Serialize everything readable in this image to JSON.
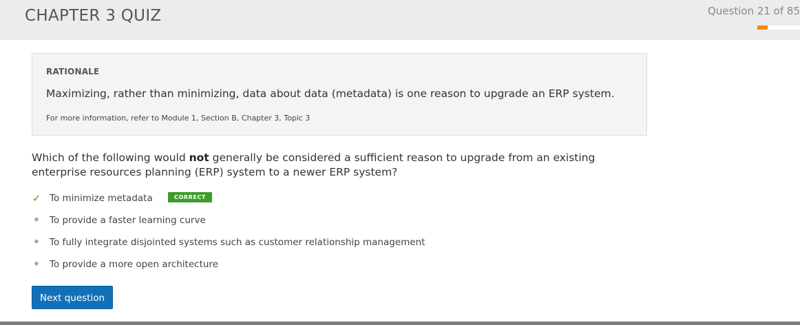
{
  "header": {
    "title": "CHAPTER 3 QUIZ",
    "progress_text": "Question 21 of 85",
    "progress": {
      "current": 21,
      "total": 85
    },
    "progress_color": "#ef8a1a"
  },
  "rationale": {
    "heading": "RATIONALE",
    "text": "Maximizing, rather than minimizing, data about data (metadata) is one reason to upgrade an ERP system.",
    "reference": "For more information, refer to Module 1, Section B, Chapter 3, Topic 3"
  },
  "question": {
    "before": "Which of the following would ",
    "emphasis": "not",
    "after": " generally be considered a sufficient reason to upgrade from an existing enterprise resources planning (ERP) system to a newer ERP system?"
  },
  "answers": [
    {
      "label": "To minimize metadata",
      "marker_icon": "check-icon",
      "correct": true,
      "badge": "CORRECT"
    },
    {
      "label": "To provide a faster learning curve",
      "marker_icon": "diamond-bullet-icon",
      "correct": false
    },
    {
      "label": "To fully integrate disjointed systems such as customer relationship management",
      "marker_icon": "diamond-bullet-icon",
      "correct": false
    },
    {
      "label": "To provide a more open architecture",
      "marker_icon": "diamond-bullet-icon",
      "correct": false
    }
  ],
  "actions": {
    "next_label": "Next question",
    "button_color": "#1270b8"
  },
  "colors": {
    "correct": "#3f9b2d",
    "header_bg": "#ececec",
    "rationale_bg": "#f4f4f4"
  }
}
